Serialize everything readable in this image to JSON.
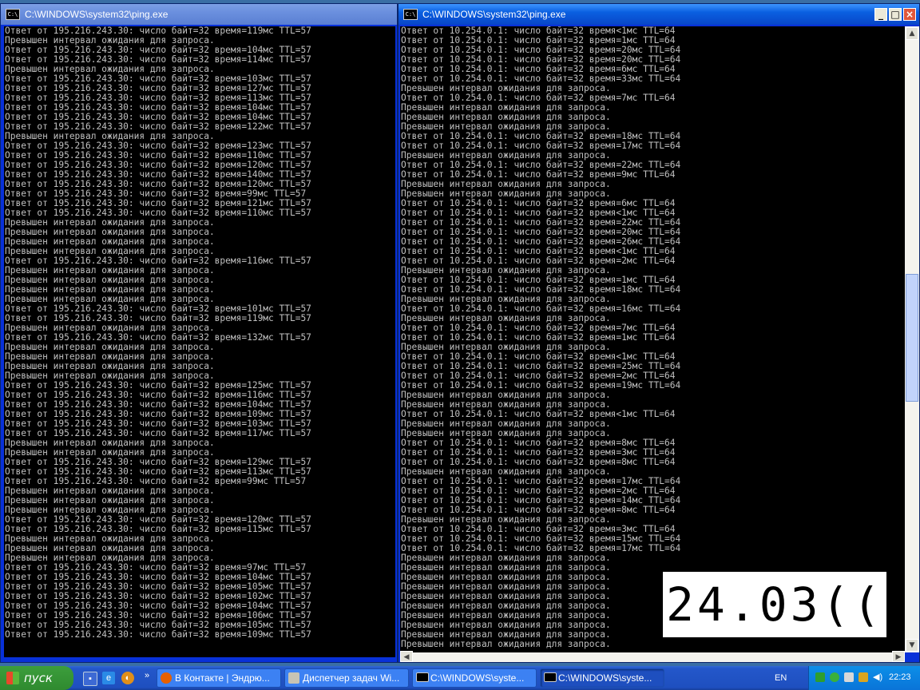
{
  "left_window": {
    "title": "C:\\WINDOWS\\system32\\ping.exe",
    "lines": [
      "Ответ от 195.216.243.30: число байт=32 время=119мс TTL=57",
      "Превышен интервал ожидания для запроса.",
      "Ответ от 195.216.243.30: число байт=32 время=104мс TTL=57",
      "Ответ от 195.216.243.30: число байт=32 время=114мс TTL=57",
      "Превышен интервал ожидания для запроса.",
      "Ответ от 195.216.243.30: число байт=32 время=103мс TTL=57",
      "Ответ от 195.216.243.30: число байт=32 время=127мс TTL=57",
      "Ответ от 195.216.243.30: число байт=32 время=113мс TTL=57",
      "Ответ от 195.216.243.30: число байт=32 время=104мс TTL=57",
      "Ответ от 195.216.243.30: число байт=32 время=104мс TTL=57",
      "Ответ от 195.216.243.30: число байт=32 время=122мс TTL=57",
      "Превышен интервал ожидания для запроса.",
      "Ответ от 195.216.243.30: число байт=32 время=123мс TTL=57",
      "Ответ от 195.216.243.30: число байт=32 время=110мс TTL=57",
      "Ответ от 195.216.243.30: число байт=32 время=120мс TTL=57",
      "Ответ от 195.216.243.30: число байт=32 время=140мс TTL=57",
      "Ответ от 195.216.243.30: число байт=32 время=120мс TTL=57",
      "Ответ от 195.216.243.30: число байт=32 время=99мс TTL=57",
      "Ответ от 195.216.243.30: число байт=32 время=121мс TTL=57",
      "Ответ от 195.216.243.30: число байт=32 время=110мс TTL=57",
      "Превышен интервал ожидания для запроса.",
      "Превышен интервал ожидания для запроса.",
      "Превышен интервал ожидания для запроса.",
      "Превышен интервал ожидания для запроса.",
      "Ответ от 195.216.243.30: число байт=32 время=116мс TTL=57",
      "Превышен интервал ожидания для запроса.",
      "Превышен интервал ожидания для запроса.",
      "Превышен интервал ожидания для запроса.",
      "Превышен интервал ожидания для запроса.",
      "Ответ от 195.216.243.30: число байт=32 время=101мс TTL=57",
      "Ответ от 195.216.243.30: число байт=32 время=119мс TTL=57",
      "Превышен интервал ожидания для запроса.",
      "Ответ от 195.216.243.30: число байт=32 время=132мс TTL=57",
      "Превышен интервал ожидания для запроса.",
      "Превышен интервал ожидания для запроса.",
      "Превышен интервал ожидания для запроса.",
      "Превышен интервал ожидания для запроса.",
      "Ответ от 195.216.243.30: число байт=32 время=125мс TTL=57",
      "Ответ от 195.216.243.30: число байт=32 время=116мс TTL=57",
      "Ответ от 195.216.243.30: число байт=32 время=104мс TTL=57",
      "Ответ от 195.216.243.30: число байт=32 время=109мс TTL=57",
      "Ответ от 195.216.243.30: число байт=32 время=103мс TTL=57",
      "Ответ от 195.216.243.30: число байт=32 время=117мс TTL=57",
      "Превышен интервал ожидания для запроса.",
      "Превышен интервал ожидания для запроса.",
      "Ответ от 195.216.243.30: число байт=32 время=129мс TTL=57",
      "Ответ от 195.216.243.30: число байт=32 время=113мс TTL=57",
      "Ответ от 195.216.243.30: число байт=32 время=99мс TTL=57",
      "Превышен интервал ожидания для запроса.",
      "Превышен интервал ожидания для запроса.",
      "Превышен интервал ожидания для запроса.",
      "Ответ от 195.216.243.30: число байт=32 время=120мс TTL=57",
      "Ответ от 195.216.243.30: число байт=32 время=115мс TTL=57",
      "Превышен интервал ожидания для запроса.",
      "Превышен интервал ожидания для запроса.",
      "Превышен интервал ожидания для запроса.",
      "Ответ от 195.216.243.30: число байт=32 время=97мс TTL=57",
      "Ответ от 195.216.243.30: число байт=32 время=104мс TTL=57",
      "Ответ от 195.216.243.30: число байт=32 время=105мс TTL=57",
      "Ответ от 195.216.243.30: число байт=32 время=102мс TTL=57",
      "Ответ от 195.216.243.30: число байт=32 время=104мс TTL=57",
      "Ответ от 195.216.243.30: число байт=32 время=106мс TTL=57",
      "Ответ от 195.216.243.30: число байт=32 время=105мс TTL=57",
      "Ответ от 195.216.243.30: число байт=32 время=109мс TTL=57"
    ]
  },
  "right_window": {
    "title": "C:\\WINDOWS\\system32\\ping.exe",
    "lines": [
      "Ответ от 10.254.0.1: число байт=32 время<1мс TTL=64",
      "Ответ от 10.254.0.1: число байт=32 время=1мс TTL=64",
      "Ответ от 10.254.0.1: число байт=32 время=20мс TTL=64",
      "Ответ от 10.254.0.1: число байт=32 время=20мс TTL=64",
      "Ответ от 10.254.0.1: число байт=32 время=6мс TTL=64",
      "Ответ от 10.254.0.1: число байт=32 время=33мс TTL=64",
      "Превышен интервал ожидания для запроса.",
      "Ответ от 10.254.0.1: число байт=32 время=7мс TTL=64",
      "Превышен интервал ожидания для запроса.",
      "Превышен интервал ожидания для запроса.",
      "Превышен интервал ожидания для запроса.",
      "Ответ от 10.254.0.1: число байт=32 время=18мс TTL=64",
      "Ответ от 10.254.0.1: число байт=32 время=17мс TTL=64",
      "Превышен интервал ожидания для запроса.",
      "Ответ от 10.254.0.1: число байт=32 время=22мс TTL=64",
      "Ответ от 10.254.0.1: число байт=32 время=9мс TTL=64",
      "Превышен интервал ожидания для запроса.",
      "Превышен интервал ожидания для запроса.",
      "Ответ от 10.254.0.1: число байт=32 время=6мс TTL=64",
      "Ответ от 10.254.0.1: число байт=32 время<1мс TTL=64",
      "Ответ от 10.254.0.1: число байт=32 время=22мс TTL=64",
      "Ответ от 10.254.0.1: число байт=32 время=20мс TTL=64",
      "Ответ от 10.254.0.1: число байт=32 время=26мс TTL=64",
      "Ответ от 10.254.0.1: число байт=32 время<1мс TTL=64",
      "Ответ от 10.254.0.1: число байт=32 время=2мс TTL=64",
      "Превышен интервал ожидания для запроса.",
      "Ответ от 10.254.0.1: число байт=32 время=1мс TTL=64",
      "Ответ от 10.254.0.1: число байт=32 время=18мс TTL=64",
      "Превышен интервал ожидания для запроса.",
      "Ответ от 10.254.0.1: число байт=32 время=16мс TTL=64",
      "Превышен интервал ожидания для запроса.",
      "Ответ от 10.254.0.1: число байт=32 время=7мс TTL=64",
      "Ответ от 10.254.0.1: число байт=32 время=1мс TTL=64",
      "Превышен интервал ожидания для запроса.",
      "Ответ от 10.254.0.1: число байт=32 время<1мс TTL=64",
      "Ответ от 10.254.0.1: число байт=32 время=25мс TTL=64",
      "Ответ от 10.254.0.1: число байт=32 время=2мс TTL=64",
      "Ответ от 10.254.0.1: число байт=32 время=19мс TTL=64",
      "Превышен интервал ожидания для запроса.",
      "Превышен интервал ожидания для запроса.",
      "Ответ от 10.254.0.1: число байт=32 время<1мс TTL=64",
      "Превышен интервал ожидания для запроса.",
      "Превышен интервал ожидания для запроса.",
      "Ответ от 10.254.0.1: число байт=32 время=8мс TTL=64",
      "Ответ от 10.254.0.1: число байт=32 время=3мс TTL=64",
      "Ответ от 10.254.0.1: число байт=32 время=8мс TTL=64",
      "Превышен интервал ожидания для запроса.",
      "Ответ от 10.254.0.1: число байт=32 время=17мс TTL=64",
      "Ответ от 10.254.0.1: число байт=32 время=2мс TTL=64",
      "Ответ от 10.254.0.1: число байт=32 время=14мс TTL=64",
      "Ответ от 10.254.0.1: число байт=32 время=8мс TTL=64",
      "Превышен интервал ожидания для запроса.",
      "Ответ от 10.254.0.1: число байт=32 время=3мс TTL=64",
      "Ответ от 10.254.0.1: число байт=32 время=15мс TTL=64",
      "Ответ от 10.254.0.1: число байт=32 время=17мс TTL=64",
      "Превышен интервал ожидания для запроса.",
      "Превышен интервал ожидания для запроса.",
      "Превышен интервал ожидания для запроса.",
      "Превышен интервал ожидания для запроса.",
      "Превышен интервал ожидания для запроса.",
      "Превышен интервал ожидания для запроса.",
      "Превышен интервал ожидания для запроса.",
      "Превышен интервал ожидания для запроса.",
      "Превышен интервал ожидания для запроса.",
      "Превышен интервал ожидания для запроса."
    ]
  },
  "overlay_text": "24.03((",
  "taskbar": {
    "start_label": "пуск",
    "buttons": [
      "В Контакте | Эндрю...",
      "Диспетчер задач Wi...",
      "C:\\WINDOWS\\syste...",
      "C:\\WINDOWS\\syste..."
    ],
    "language": "EN",
    "clock": "22:23"
  },
  "colors": {
    "desktop": "#3a6ea5",
    "console_bg": "#000000",
    "console_text": "#c0c0c0",
    "taskbar": "#245edb",
    "start_button": "#3c9e3c"
  }
}
